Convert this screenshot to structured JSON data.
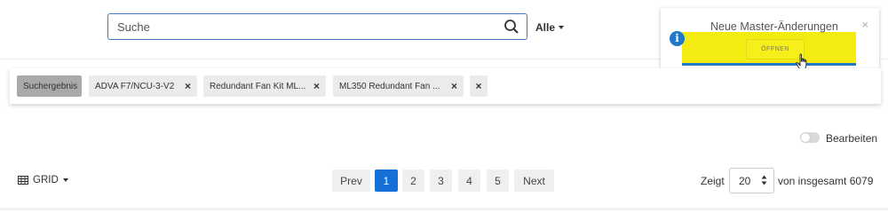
{
  "search": {
    "placeholder": "Suche",
    "scope_label": "Alle"
  },
  "toast": {
    "title": "Neue Master-Änderungen",
    "close": "×",
    "info": "i",
    "open_label": "ÖFFNEN"
  },
  "tabs": [
    {
      "label": "Suchergebnis"
    },
    {
      "label": "ADVA F7/NCU-3-V2",
      "close": "×"
    },
    {
      "label": "Redundant Fan Kit ML...",
      "close": "×"
    },
    {
      "label": "ML350 Redundant Fan ...",
      "close": "×"
    }
  ],
  "tabs_close_all": "×",
  "edit_toggle": {
    "label": "Bearbeiten",
    "on": false
  },
  "view": {
    "label": "GRID"
  },
  "pagination": {
    "prev": "Prev",
    "next": "Next",
    "pages": [
      "1",
      "2",
      "3",
      "4",
      "5"
    ],
    "current": "1"
  },
  "page_size": {
    "prefix": "Zeigt",
    "value": "20",
    "total_text": "von insgesamt 6079"
  },
  "colors": {
    "accent": "#1570d8",
    "highlight": "#f4ec10",
    "search_border": "#4a78c4"
  }
}
